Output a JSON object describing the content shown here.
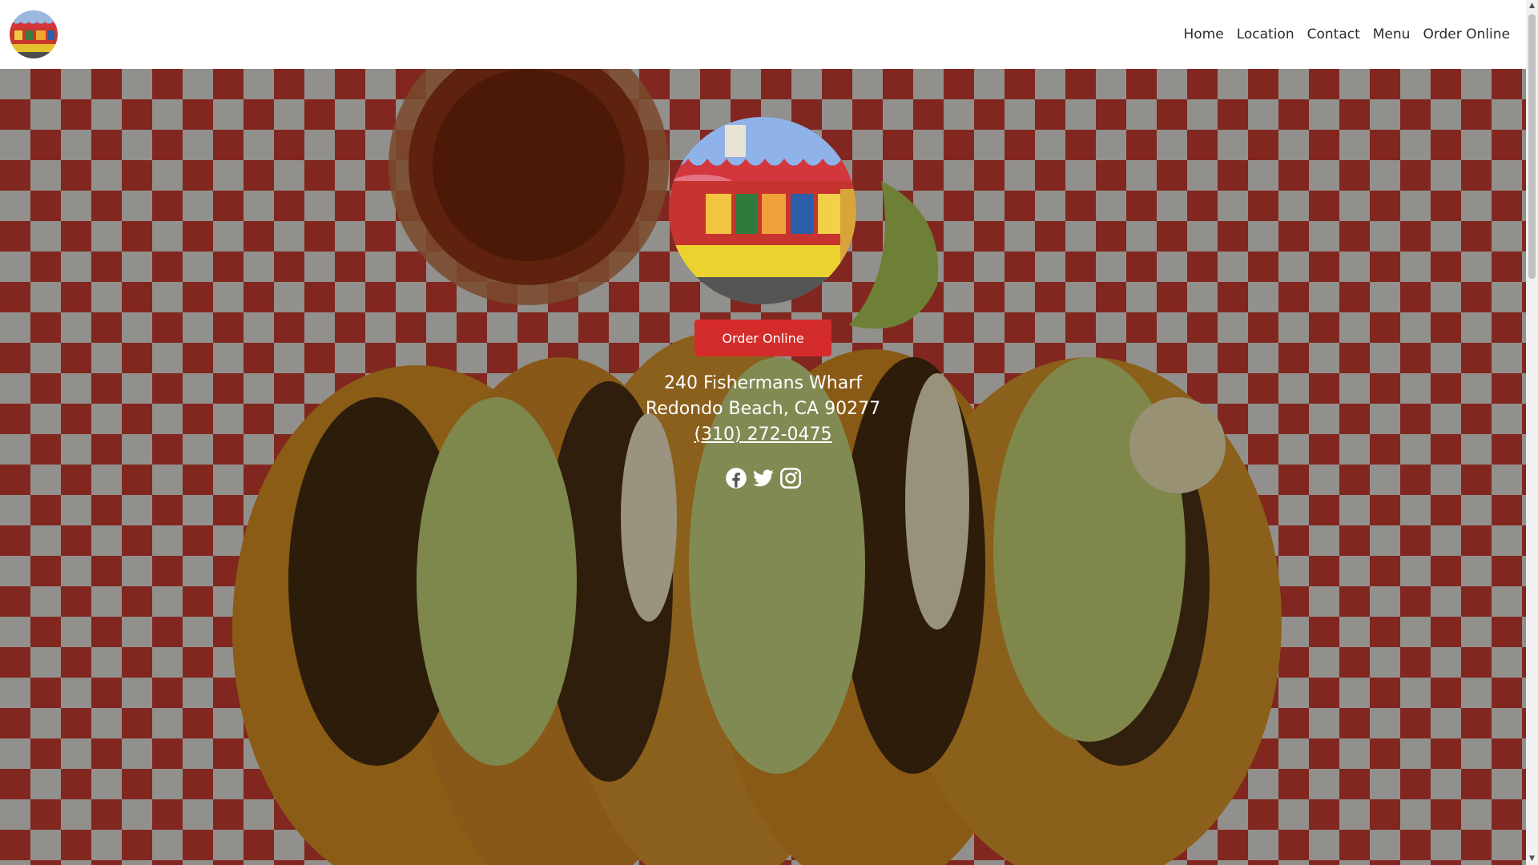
{
  "header": {
    "nav": [
      {
        "label": "Home"
      },
      {
        "label": "Location"
      },
      {
        "label": "Contact"
      },
      {
        "label": "Menu"
      },
      {
        "label": "Order Online"
      }
    ]
  },
  "hero": {
    "order_button_label": "Order Online",
    "address_line1": "240 Fishermans Wharf",
    "address_line2": "Redondo Beach, CA 90277",
    "phone": "(310) 272-0475",
    "social": [
      {
        "icon": "facebook-icon"
      },
      {
        "icon": "twitter-icon"
      },
      {
        "icon": "instagram-icon"
      }
    ]
  },
  "colors": {
    "accent": "#d42b2b",
    "checker_red": "#d84234",
    "checker_white": "#f4f1ea"
  },
  "scrollbar": {
    "up_glyph": "▲",
    "down_glyph": "▼"
  }
}
